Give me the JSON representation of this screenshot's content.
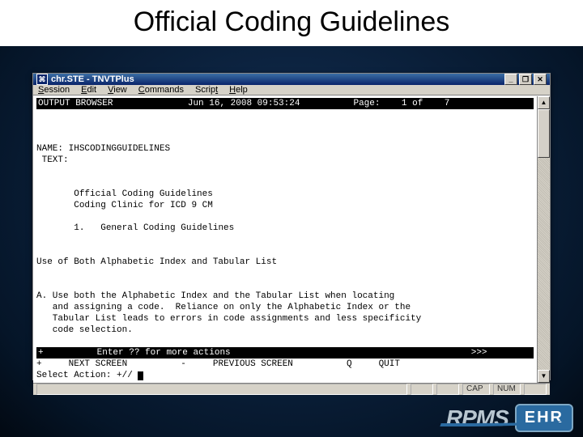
{
  "slide_title": "Official Coding Guidelines",
  "window": {
    "title": "chr.STE - TNVTPlus",
    "min_glyph": "_",
    "restore_glyph": "❐",
    "close_glyph": "✕"
  },
  "menu": {
    "session": "Session",
    "edit": "Edit",
    "view": "View",
    "commands": "Commands",
    "script": "Script",
    "help": "Help"
  },
  "terminal": {
    "header_left": "OUTPUT BROWSER",
    "header_date": "Jun 16, 2008 09:53:24",
    "header_page_lbl": "Page:",
    "header_page_cur": "1",
    "header_page_of": "of",
    "header_page_tot": "7",
    "name_lbl": "NAME:",
    "name_val": "IHSCODINGGUIDELINES",
    "text_lbl": "TEXT:",
    "body_l1": "Official Coding Guidelines",
    "body_l2": "Coding Clinic for ICD 9 CM",
    "body_l3": "1.   General Coding Guidelines",
    "section_hdr": "Use of Both Alphabetic Index and Tabular List",
    "para_a1": "A. Use both the Alphabetic Index and the Tabular List when locating",
    "para_a2": "   and assigning a code.  Reliance on only the Alphabetic Index or the",
    "para_a3": "   Tabular List leads to errors in code assignments and less specificity",
    "para_a4": "   code selection.",
    "footer_hint_left": "+",
    "footer_hint": "Enter ?? for more actions",
    "footer_hint_right": ">>>",
    "nav_plus": "+",
    "nav_next": "NEXT SCREEN",
    "nav_minus": "-",
    "nav_prev": "PREVIOUS SCREEN",
    "nav_q": "Q",
    "nav_quit": "QUIT",
    "prompt_lbl": "Select Action:",
    "prompt_val": "+//"
  },
  "status": {
    "cap": "CAP",
    "num": "NUM"
  },
  "brand": {
    "rpms": "RPMS",
    "ehr": "EHR"
  }
}
